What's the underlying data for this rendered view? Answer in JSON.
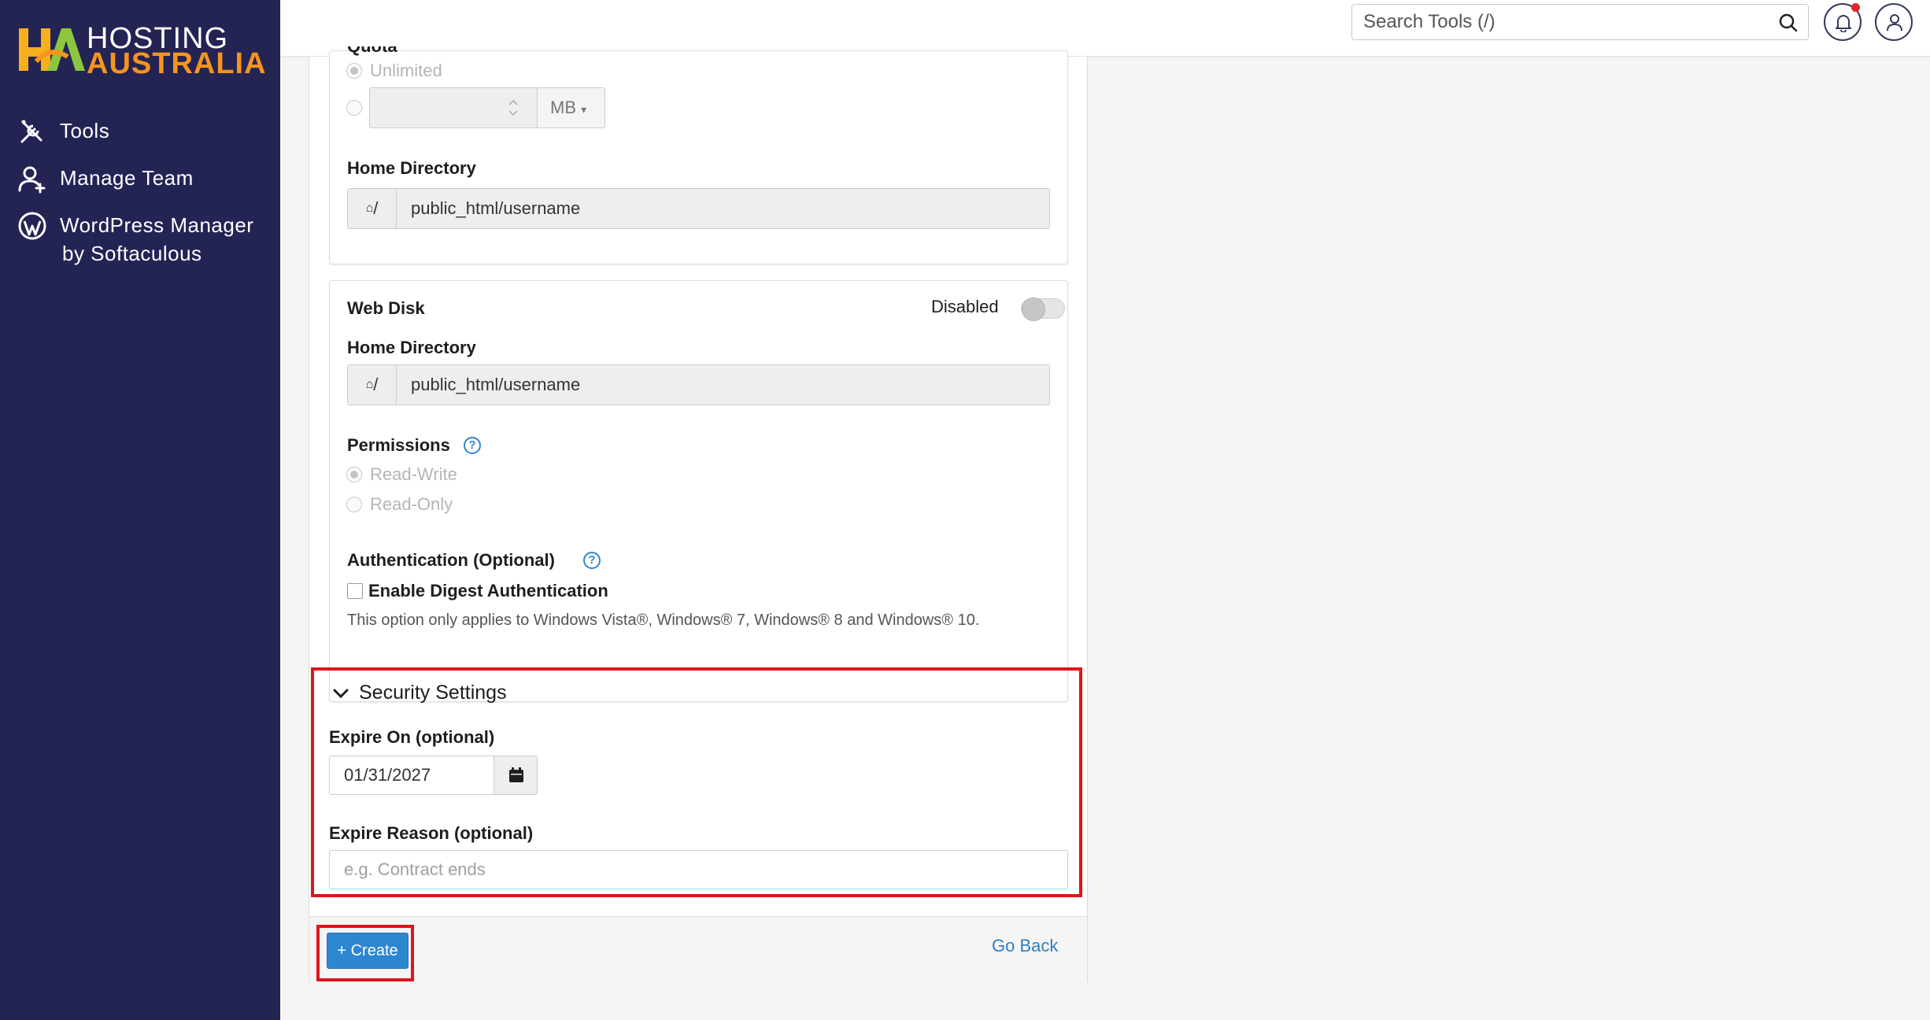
{
  "brand": {
    "line1": "HOSTING",
    "line2": "AUSTRALIA",
    "accent_color": "#f7941d",
    "sidebar_color": "#232454"
  },
  "sidebar": {
    "items": [
      {
        "label": "Tools",
        "icon": "tools-icon"
      },
      {
        "label": "Manage Team",
        "icon": "manage-team-icon"
      },
      {
        "label": "WordPress Manager",
        "label2": "by Softaculous",
        "icon": "wordpress-icon"
      }
    ]
  },
  "topbar": {
    "search_placeholder": "Search Tools (/)",
    "notification_icon": "bell-icon",
    "user_icon": "user-icon"
  },
  "form": {
    "quota": {
      "label_partial": "Quota",
      "unlimited_label": "Unlimited",
      "unit": "MB"
    },
    "ftp_home": {
      "label": "Home Directory",
      "prefix": "/",
      "value": "public_html/username"
    },
    "web_disk": {
      "title": "Web Disk",
      "toggle_label": "Disabled",
      "home_label": "Home Directory",
      "home_prefix": "/",
      "home_value": "public_html/username",
      "permissions_label": "Permissions",
      "perm_read_write": "Read-Write",
      "perm_read_only": "Read-Only",
      "auth_label": "Authentication (Optional)",
      "digest_label": "Enable Digest Authentication",
      "note": "This option only applies to Windows Vista®, Windows® 7, Windows® 8 and Windows® 10."
    },
    "security": {
      "title": "Security Settings",
      "expire_on_label": "Expire On (optional)",
      "expire_on_value": "01/31/2027",
      "expire_reason_label": "Expire Reason (optional)",
      "expire_reason_placeholder": "e.g. Contract ends"
    },
    "actions": {
      "create_label": "+ Create",
      "back_label": "Go Back"
    }
  },
  "colors": {
    "primary": "#2e86d1",
    "highlight": "#e0141b"
  }
}
